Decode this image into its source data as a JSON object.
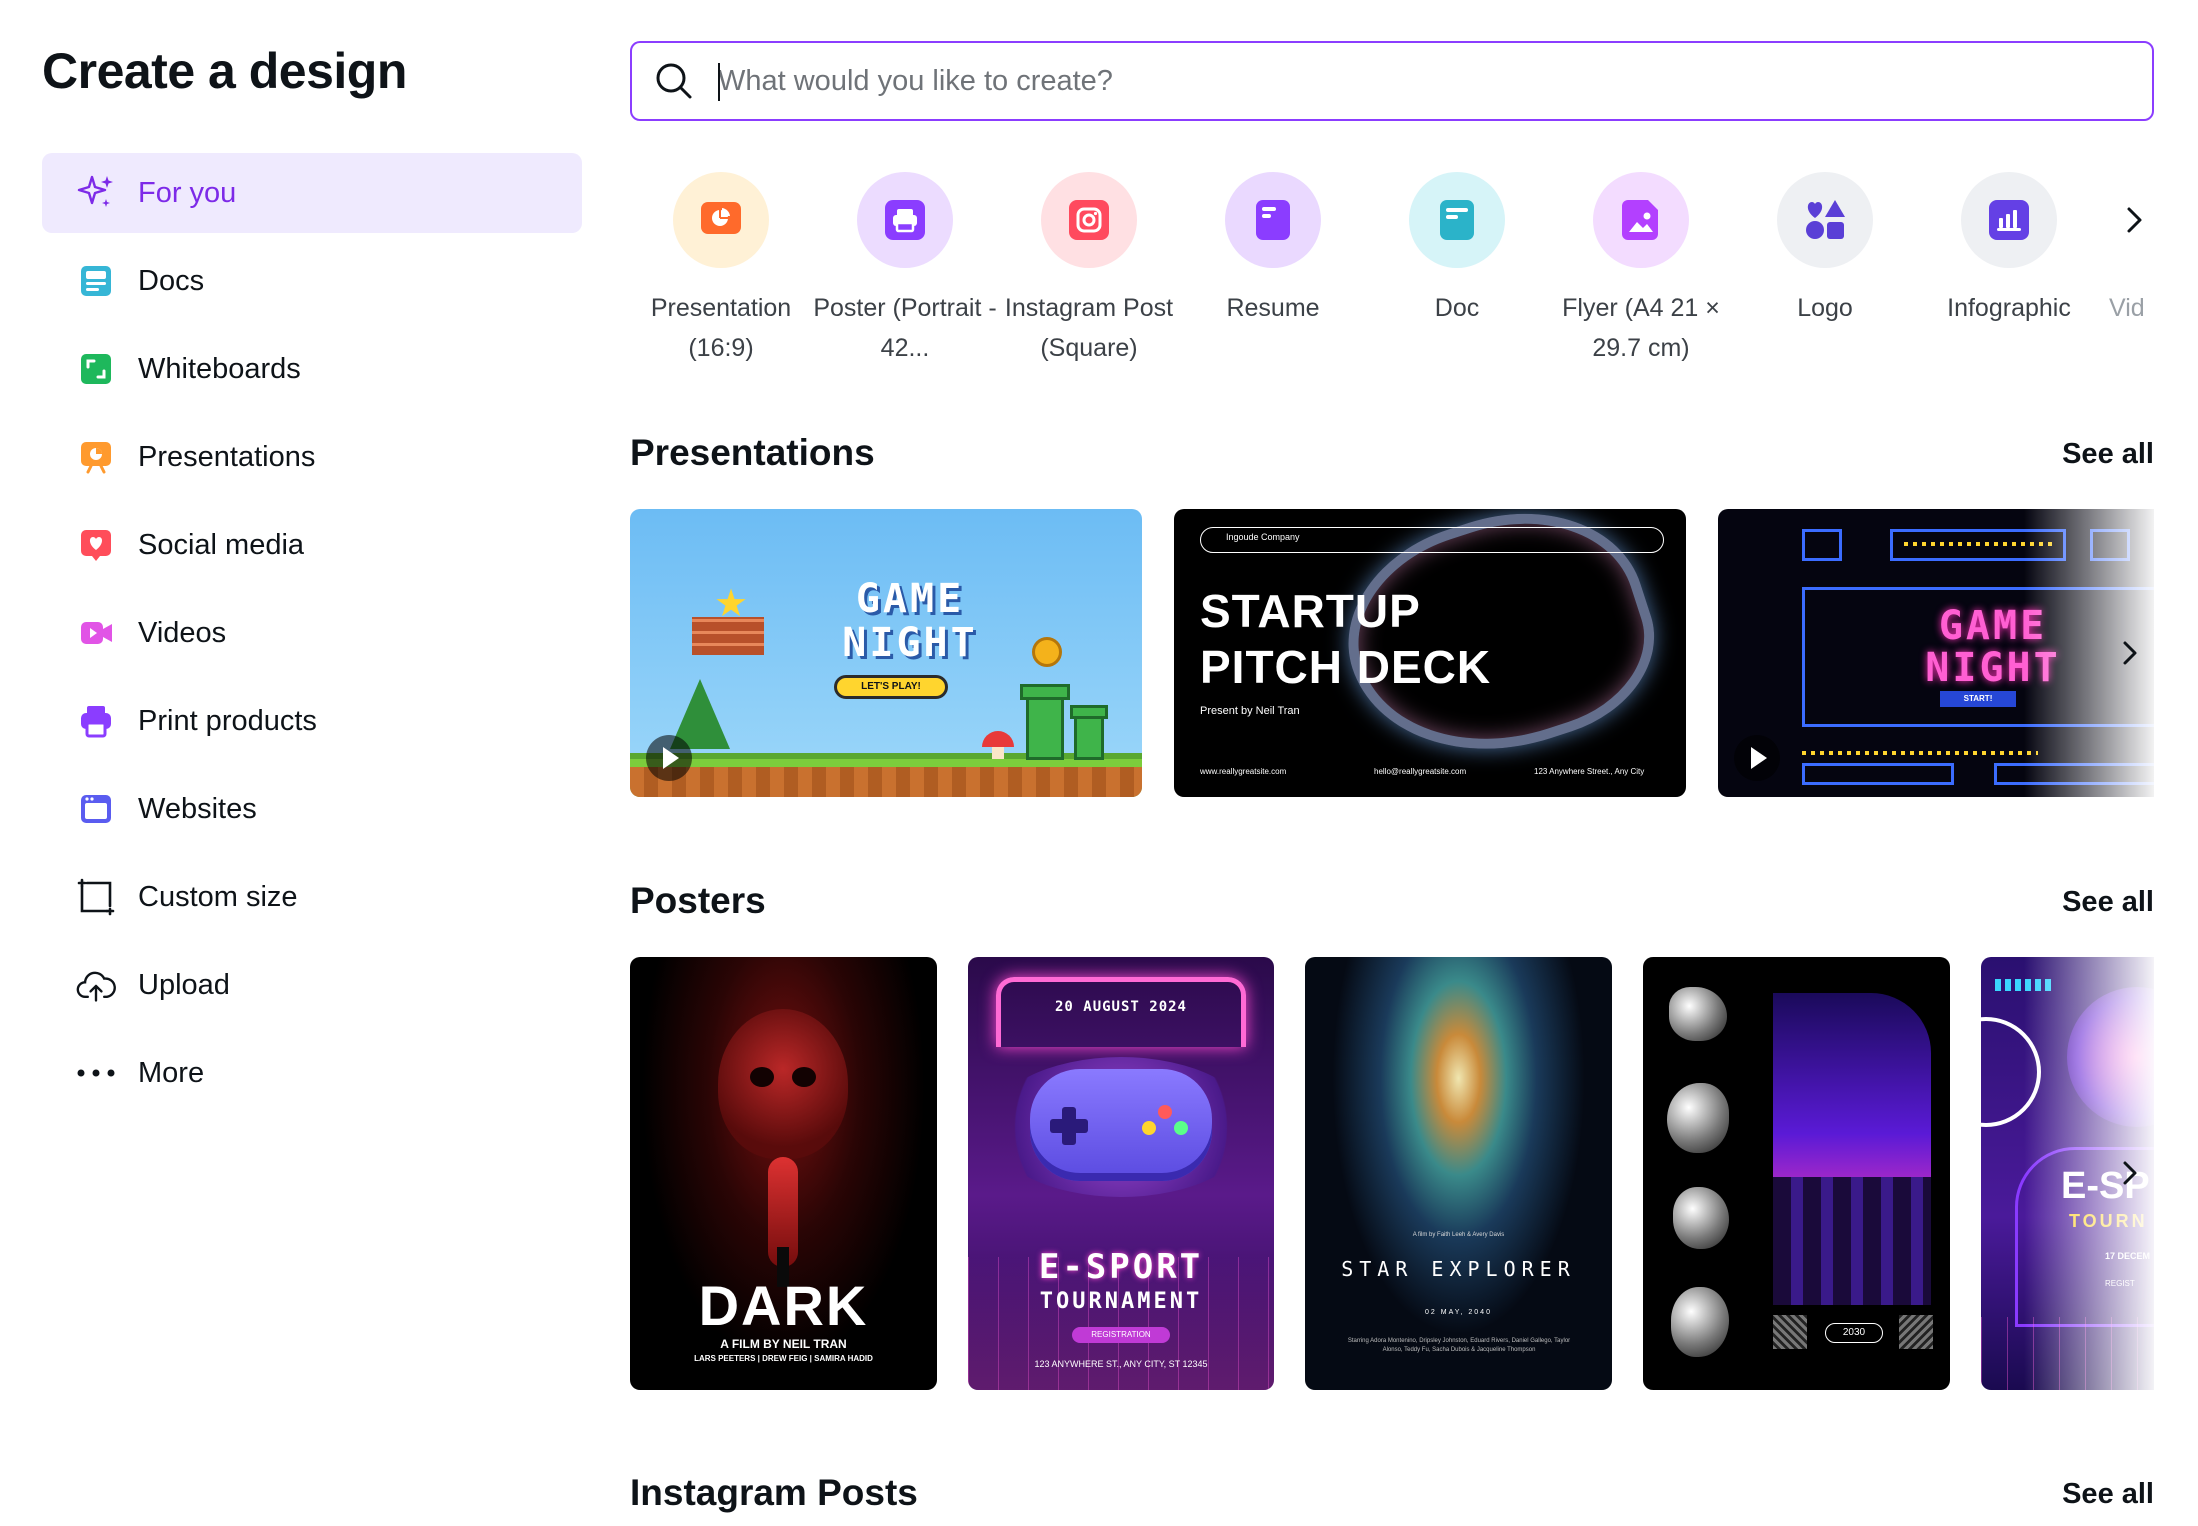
{
  "sidebar": {
    "title": "Create a design",
    "items": [
      {
        "label": "For you",
        "icon": "sparkle-icon",
        "active": true
      },
      {
        "label": "Docs",
        "icon": "docs-icon"
      },
      {
        "label": "Whiteboards",
        "icon": "whiteboard-icon"
      },
      {
        "label": "Presentations",
        "icon": "presentation-icon"
      },
      {
        "label": "Social media",
        "icon": "heart-icon"
      },
      {
        "label": "Videos",
        "icon": "video-icon"
      },
      {
        "label": "Print products",
        "icon": "printer-icon"
      },
      {
        "label": "Websites",
        "icon": "website-icon"
      },
      {
        "label": "Custom size",
        "icon": "custom-size-icon"
      },
      {
        "label": "Upload",
        "icon": "cloud-upload-icon"
      },
      {
        "label": "More",
        "icon": "more-dots-icon"
      }
    ]
  },
  "search": {
    "placeholder": "What would you like to create?",
    "value": ""
  },
  "design_types": [
    {
      "label": "Presentation (16:9)",
      "icon": "presentation-type-icon"
    },
    {
      "label": "Poster (Portrait - 42...",
      "icon": "poster-type-icon"
    },
    {
      "label": "Instagram Post (Square)",
      "icon": "instagram-type-icon"
    },
    {
      "label": "Resume",
      "icon": "resume-type-icon"
    },
    {
      "label": "Doc",
      "icon": "doc-type-icon"
    },
    {
      "label": "Flyer (A4 21 × 29.7 cm)",
      "icon": "flyer-type-icon"
    },
    {
      "label": "Logo",
      "icon": "logo-type-icon"
    },
    {
      "label": "Infographic",
      "icon": "infographic-type-icon"
    },
    {
      "label": "Vid",
      "icon": "video-type-icon"
    }
  ],
  "sections": {
    "presentations": {
      "title": "Presentations",
      "see_all": "See all"
    },
    "posters": {
      "title": "Posters",
      "see_all": "See all"
    },
    "instagram": {
      "title": "Instagram Posts",
      "see_all": "See all"
    }
  },
  "templates": {
    "pres1": {
      "title_line1": "GAME",
      "title_line2": "NIGHT",
      "button": "LET'S PLAY!"
    },
    "pres2": {
      "company": "Ingoude Company",
      "title_line1": "STARTUP",
      "title_line2": "PITCH DECK",
      "subtitle": "Present by Neil Tran",
      "website": "www.reallygreatsite.com",
      "email": "hello@reallygreatsite.com",
      "address": "123 Anywhere Street., Any City"
    },
    "pres3": {
      "title_line1": "GAME",
      "title_line2": "NIGHT",
      "button": "START!"
    },
    "poster1": {
      "title": "DARK",
      "subtitle": "A FILM BY NEIL TRAN",
      "credits": "LARS PEETERS | DREW FEIG | SAMIRA HADID"
    },
    "poster2": {
      "date": "20 AUGUST 2024",
      "title_line1": "E-SPORT",
      "title_line2": "TOURNAMENT",
      "button": "REGISTRATION",
      "address": "123 ANYWHERE ST., ANY CITY, ST 12345"
    },
    "poster3": {
      "credit": "A film by Faith Leeh & Avery Davis",
      "title": "STAR EXPLORER",
      "date": "02 MAY, 2040",
      "cast": "Starring Adora Montenino, Dripsley Johnston, Eduard Rivers, Daniel Gallego, Taylor Alonso, Teddy Fu, Sacha Dubois & Jacqueline Thompson"
    },
    "poster4": {
      "year": "2030"
    },
    "poster5": {
      "title": "E-SP",
      "subtitle": "TOURN",
      "date": "17 DECEM",
      "button": "REGIST"
    }
  },
  "colors": {
    "accent": "#8b3dff",
    "active_bg": "#efeafe"
  }
}
